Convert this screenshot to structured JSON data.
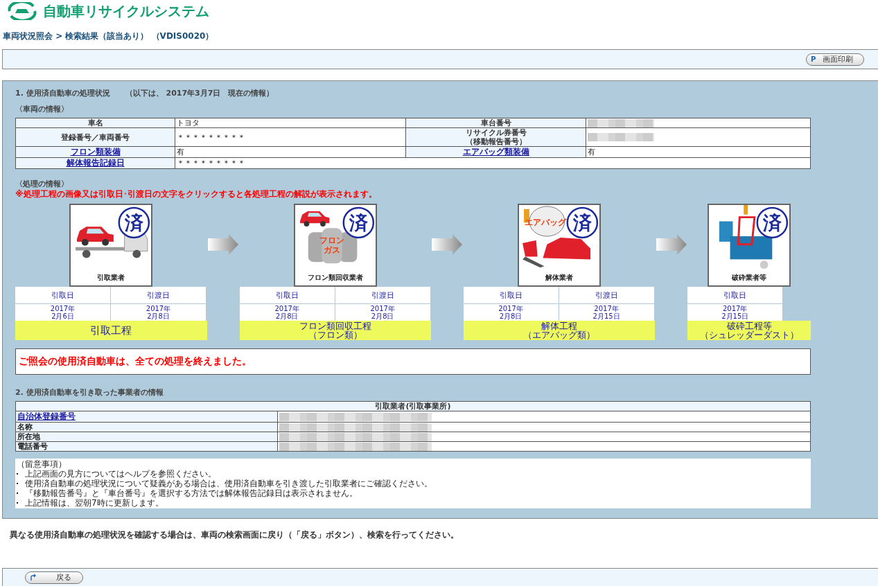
{
  "logo": {
    "text": "自動車リサイクルシステム"
  },
  "breadcrumb": "車両状況照会 > 検索結果（該当あり） （VDIS0020）",
  "toolbar": {
    "print_button": "画面印刷",
    "print_icon": "P"
  },
  "section1": {
    "title": "1. 使用済自動車の処理状況",
    "as_of": "（以下は、 2017年3月7日　現在の情報）",
    "vehicle_heading": "〈車両の情報〉",
    "vehicle_rows": [
      {
        "cells": [
          {
            "label": "車名",
            "link": false,
            "value": "トヨタ"
          },
          {
            "label": "車台番号",
            "link": false,
            "redacted": true
          }
        ]
      },
      {
        "cells": [
          {
            "label": "登録番号／車両番号",
            "link": false,
            "value": "＊＊＊＊＊＊＊＊＊"
          },
          {
            "label": [
              "リサイクル券番号",
              "（移動報告番号）"
            ],
            "link": false,
            "redacted": true
          }
        ]
      },
      {
        "cells": [
          {
            "label": "フロン類装備",
            "link": true,
            "value": "有"
          },
          {
            "label": "エアバッグ類装備",
            "link": true,
            "value": "有"
          }
        ]
      },
      {
        "cells": [
          {
            "label": "解体報告記録日",
            "link": true,
            "value": "＊＊＊＊＊＊＊＊＊"
          }
        ]
      }
    ],
    "process_heading": "〈処理の情報〉",
    "process_note": "※処理工程の画像又は引取日･引渡日の文字をクリックすると各処理工程の解説が表示されます。",
    "steps": [
      {
        "kind": "tow",
        "stamp": "済",
        "caption": "引取業者",
        "dates": [
          {
            "label": "引取日",
            "year": "2017年",
            "day": "2月6日"
          },
          {
            "label": "引渡日",
            "year": "2017年",
            "day": "2月8日"
          }
        ],
        "title_lines": [
          "引取工程"
        ]
      },
      {
        "kind": "freon",
        "stamp": "済",
        "caption": "フロン類回収業者",
        "art_label": [
          "フロン",
          "ガス"
        ],
        "dates": [
          {
            "label": "引取日",
            "year": "2017年",
            "day": "2月8日"
          },
          {
            "label": "引渡日",
            "year": "2017年",
            "day": "2月8日"
          }
        ],
        "title_lines": [
          "フロン類回収工程",
          "（フロン類）"
        ]
      },
      {
        "kind": "dismantle",
        "stamp": "済",
        "caption": "解体業者",
        "art_label": [
          "エアバッグ"
        ],
        "dates": [
          {
            "label": "引取日",
            "year": "2017年",
            "day": "2月8日"
          },
          {
            "label": "引渡日",
            "year": "2017年",
            "day": "2月15日"
          }
        ],
        "title_lines": [
          "解体工程",
          "（エアバッグ類）"
        ]
      },
      {
        "kind": "shred",
        "stamp": "済",
        "caption": "破砕業者等",
        "dates": [
          {
            "label": "引取日",
            "year": "2017年",
            "day": "2月15日"
          }
        ],
        "title_lines": [
          "破砕工程等",
          "（シュレッダーダスト）"
        ]
      }
    ],
    "result_message": "ご照会の使用済自動車は、全ての処理を終えました。"
  },
  "section2": {
    "title": "2. 使用済自動車を引き取った事業者の情報",
    "table_header": "引取業者(引取事業所)",
    "rows": [
      {
        "label": "自治体登録番号",
        "link": true,
        "redacted": true
      },
      {
        "label": "名称",
        "link": false,
        "redacted": true
      },
      {
        "label": "所在地",
        "link": false,
        "redacted": true
      },
      {
        "label": "電話番号",
        "link": false,
        "redacted": true
      }
    ]
  },
  "notes": {
    "heading": "（留意事項）",
    "items": [
      "上記画面の見方についてはヘルプを参照ください。",
      "使用済自動車の処理状況について疑義がある場合は、使用済自動車を引き渡した引取業者にご確認ください。",
      "『移動報告番号』と『車台番号』を選択する方法では解体報告記録日は表示されません。",
      "上記情報は、翌朝7時に更新します。"
    ]
  },
  "instruction": "異なる使用済自動車の処理状況を確認する場合は、車両の検索画面に戻り（「戻る」ボタン）、検索を行ってください。",
  "footer": {
    "back_button": "戻る"
  }
}
